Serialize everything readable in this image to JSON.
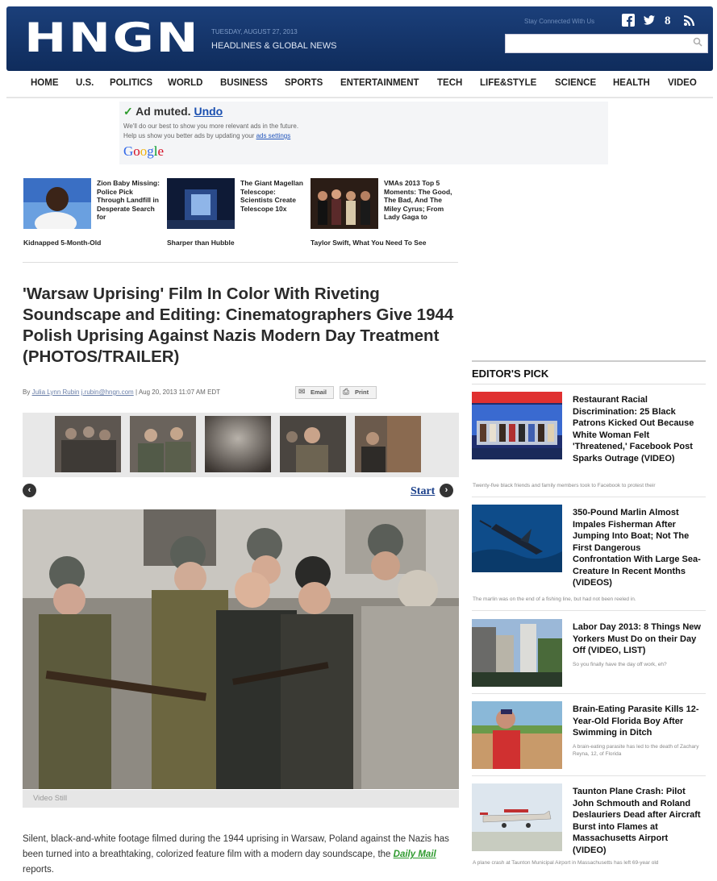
{
  "header": {
    "logo": "HNGN",
    "date": "TUESDAY, AUGUST 27, 2013",
    "tagline": "HEADLINES & GLOBAL NEWS",
    "stay_connected": "Stay Connected With Us",
    "social_icons": [
      "facebook-icon",
      "twitter-icon",
      "google-plus-icon",
      "rss-icon"
    ],
    "search_placeholder": ""
  },
  "nav": [
    "HOME",
    "U.S.",
    "POLITICS",
    "WORLD",
    "BUSINESS",
    "SPORTS",
    "ENTERTAINMENT",
    "TECH",
    "LIFE&STYLE",
    "SCIENCE",
    "HEALTH",
    "VIDEO"
  ],
  "ad": {
    "title": "Ad muted.",
    "undo": "Undo",
    "line1": "We'll do our best to show you more relevant ads in the future.",
    "line2_prefix": "Help us show you better ads by updating your",
    "line2_link": "ads settings",
    "brand": "Google"
  },
  "related": [
    {
      "text_top": "Zion Baby Missing: Police Pick Through Landfill in Desperate Search for",
      "text_bottom": "Kidnapped 5-Month-Old"
    },
    {
      "text_top": "The Giant Magellan Telescope: Scientists Create Telescope 10x",
      "text_bottom": "Sharper than Hubble"
    },
    {
      "text_top": "VMAs 2013 Top 5 Moments: The Good, The Bad, And The Miley Cyrus; From Lady Gaga to",
      "text_bottom": "Taylor Swift, What You Need To See"
    }
  ],
  "article": {
    "title": "'Warsaw Uprising' Film In Color With Riveting Soundscape and Editing: Cinematographers Give 1944 Polish Uprising Against Nazis Modern Day Treatment (PHOTOS/TRAILER)",
    "by": "By",
    "author": "Julia Lynn Rubin",
    "email": "j.rubin@hngn.com",
    "date": "| Aug 20, 2013 11:07 AM EDT",
    "email_btn": "Email",
    "print_btn": "Print",
    "start": "Start",
    "caption": "Video Still",
    "body_1": "Silent, black-and-white footage filmed during the 1944 uprising in Warsaw, Poland against the Nazis has been turned into a breathtaking, colorized feature film with a modern day soundscape, the",
    "body_link": "Daily Mail",
    "body_2": "reports."
  },
  "editors_pick": {
    "heading": "EDITOR'S PICK",
    "items": [
      {
        "title": "Restaurant Racial Discrimination: 25 Black Patrons Kicked Out Because White Woman Felt 'Threatened,' Facebook Post Sparks Outrage (VIDEO)",
        "desc": "Twenty-five black friends and family members took to Facebook to protest their"
      },
      {
        "title": "350-Pound Marlin Almost Impales Fisherman After Jumping Into Boat; Not The First Dangerous Confrontation With Large Sea-Creature In Recent Months (VIDEOS)",
        "desc": "The marlin was on the end of a fishing line, but had not been reeled in."
      },
      {
        "title": "Labor Day 2013: 8 Things New Yorkers Must Do on their Day Off (VIDEO, LIST)",
        "desc": "So you finally have the day off work, eh?"
      },
      {
        "title": "Brain-Eating Parasite Kills 12-Year-Old Florida Boy After Swimming in Ditch",
        "desc": "A brain-eating parasite has led to the death of Zachary Reyna, 12, of Florida"
      },
      {
        "title": "Taunton Plane Crash: Pilot John Schmouth and Roland Deslauriers Dead after Aircraft Burst into Flames at Massachusetts Airport (VIDEO)",
        "desc": "A plane crash at Taunton Municipal Airport in Massachusetts has left 69-year old"
      }
    ]
  }
}
